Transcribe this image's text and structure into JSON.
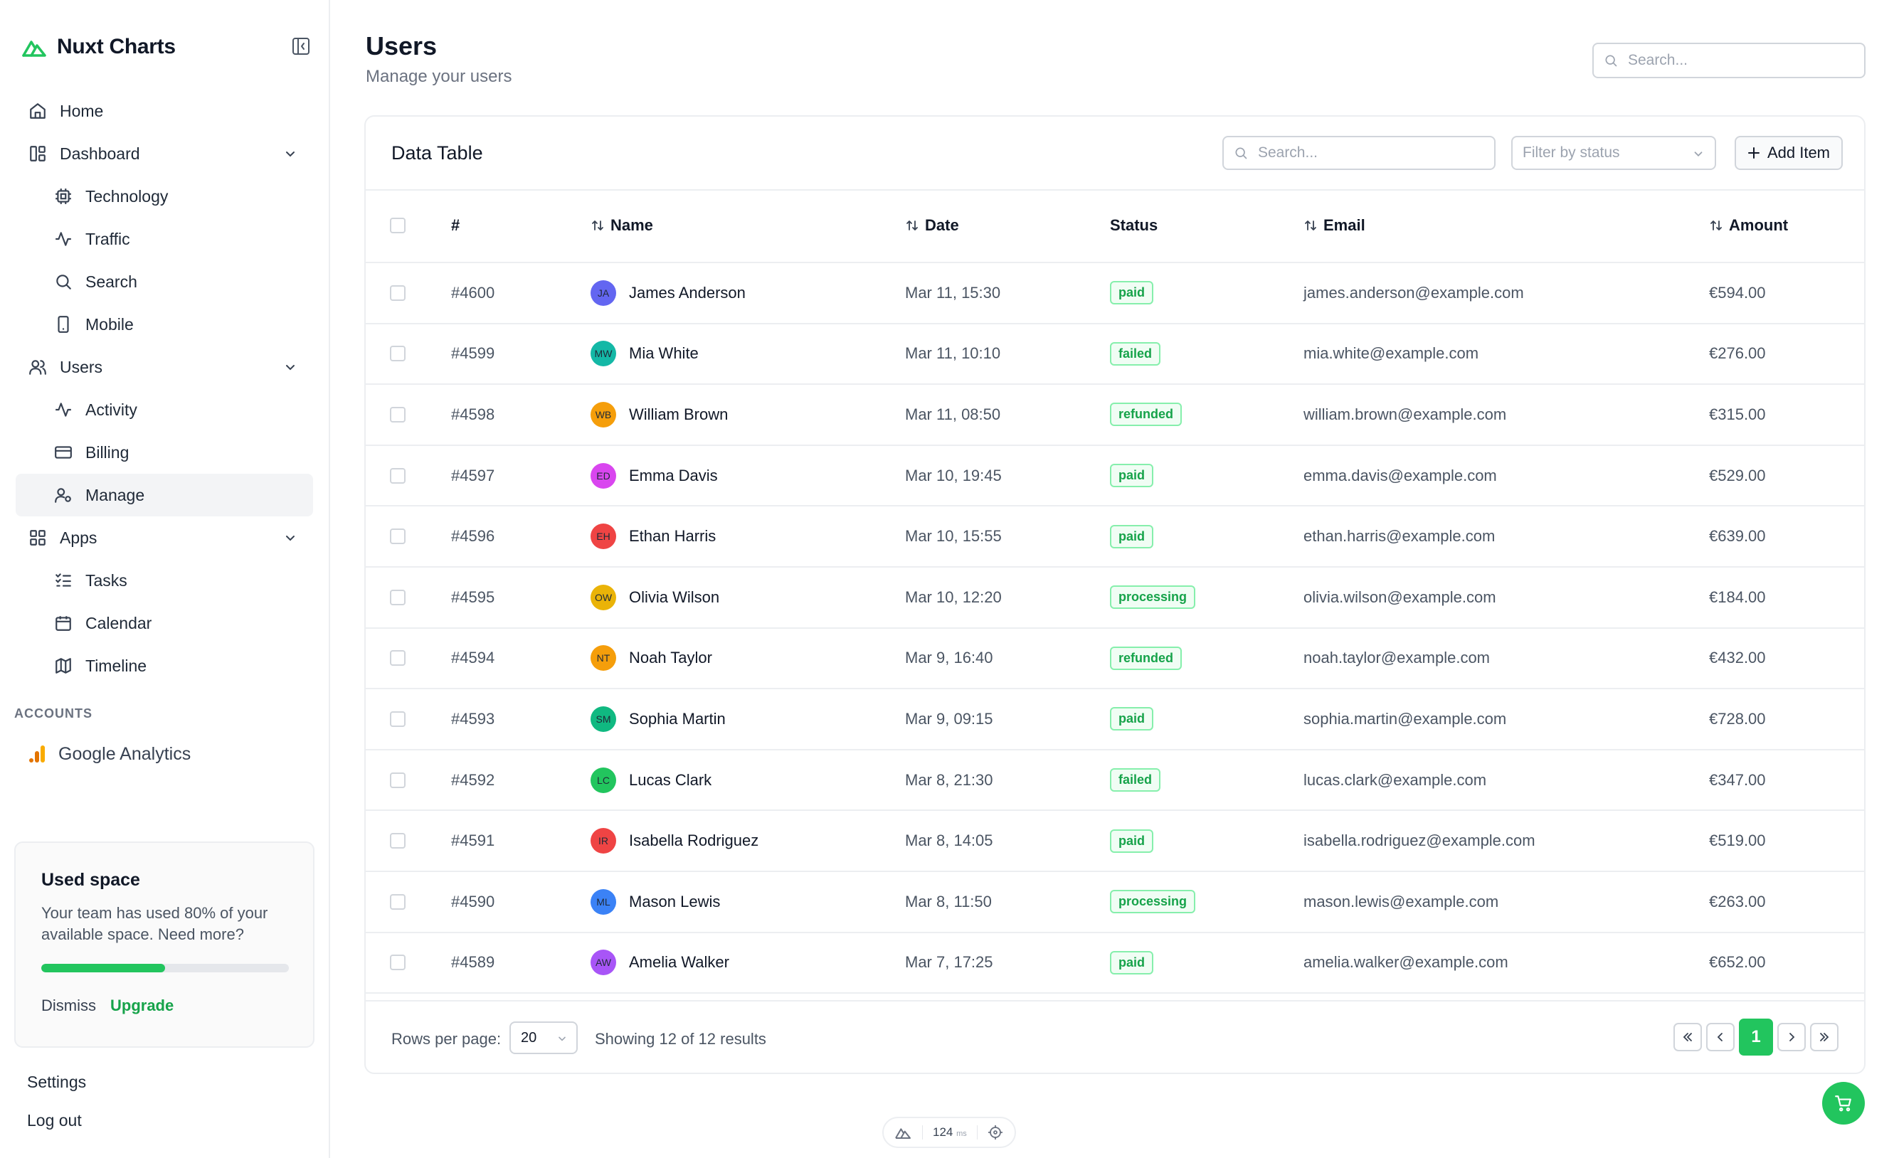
{
  "brand": {
    "name": "Nuxt Charts",
    "accent": "#22c55e"
  },
  "sidebar": {
    "items": [
      {
        "label": "Home",
        "icon": "home-icon",
        "level": 0
      },
      {
        "label": "Dashboard",
        "icon": "dashboard-icon",
        "level": 0,
        "expandable": true
      },
      {
        "label": "Technology",
        "icon": "cpu-icon",
        "level": 1
      },
      {
        "label": "Traffic",
        "icon": "activity-icon",
        "level": 1
      },
      {
        "label": "Search",
        "icon": "search-icon",
        "level": 1
      },
      {
        "label": "Mobile",
        "icon": "smartphone-icon",
        "level": 1
      },
      {
        "label": "Users",
        "icon": "users-icon",
        "level": 0,
        "expandable": true
      },
      {
        "label": "Activity",
        "icon": "activity-icon",
        "level": 1
      },
      {
        "label": "Billing",
        "icon": "credit-card-icon",
        "level": 1
      },
      {
        "label": "Manage",
        "icon": "user-cog-icon",
        "level": 1,
        "active": true
      },
      {
        "label": "Apps",
        "icon": "grid-icon",
        "level": 0,
        "expandable": true
      },
      {
        "label": "Tasks",
        "icon": "list-checks-icon",
        "level": 1
      },
      {
        "label": "Calendar",
        "icon": "calendar-icon",
        "level": 1
      },
      {
        "label": "Timeline",
        "icon": "map-icon",
        "level": 1
      }
    ],
    "accounts_label": "ACCOUNTS",
    "account": {
      "label": "Google Analytics",
      "icon": "google-analytics-icon"
    },
    "used_space": {
      "title": "Used space",
      "text": "Your team has used 80% of your available space. Need more?",
      "percent": 50,
      "dismiss": "Dismiss",
      "upgrade": "Upgrade"
    },
    "settings": "Settings",
    "logout": "Log out"
  },
  "header": {
    "title": "Users",
    "subtitle": "Manage your users",
    "search_placeholder": "Search..."
  },
  "table_card": {
    "title": "Data Table",
    "search_placeholder": "Search...",
    "filter_placeholder": "Filter by status",
    "add_label": "Add Item",
    "columns": {
      "id": "#",
      "name": "Name",
      "date": "Date",
      "status": "Status",
      "email": "Email",
      "amount": "Amount"
    },
    "rows": [
      {
        "id": "#4600",
        "initials": "JA",
        "avatar": "#6366f1",
        "name": "James Anderson",
        "date": "Mar 11, 15:30",
        "status": "paid",
        "email": "james.anderson@example.com",
        "amount": "€594.00"
      },
      {
        "id": "#4599",
        "initials": "MW",
        "avatar": "#14b8a6",
        "name": "Mia White",
        "date": "Mar 11, 10:10",
        "status": "failed",
        "email": "mia.white@example.com",
        "amount": "€276.00"
      },
      {
        "id": "#4598",
        "initials": "WB",
        "avatar": "#f59e0b",
        "name": "William Brown",
        "date": "Mar 11, 08:50",
        "status": "refunded",
        "email": "william.brown@example.com",
        "amount": "€315.00"
      },
      {
        "id": "#4597",
        "initials": "ED",
        "avatar": "#d946ef",
        "name": "Emma Davis",
        "date": "Mar 10, 19:45",
        "status": "paid",
        "email": "emma.davis@example.com",
        "amount": "€529.00"
      },
      {
        "id": "#4596",
        "initials": "EH",
        "avatar": "#ef4444",
        "name": "Ethan Harris",
        "date": "Mar 10, 15:55",
        "status": "paid",
        "email": "ethan.harris@example.com",
        "amount": "€639.00"
      },
      {
        "id": "#4595",
        "initials": "OW",
        "avatar": "#eab308",
        "name": "Olivia Wilson",
        "date": "Mar 10, 12:20",
        "status": "processing",
        "email": "olivia.wilson@example.com",
        "amount": "€184.00"
      },
      {
        "id": "#4594",
        "initials": "NT",
        "avatar": "#f59e0b",
        "name": "Noah Taylor",
        "date": "Mar 9, 16:40",
        "status": "refunded",
        "email": "noah.taylor@example.com",
        "amount": "€432.00"
      },
      {
        "id": "#4593",
        "initials": "SM",
        "avatar": "#10b981",
        "name": "Sophia Martin",
        "date": "Mar 9, 09:15",
        "status": "paid",
        "email": "sophia.martin@example.com",
        "amount": "€728.00"
      },
      {
        "id": "#4592",
        "initials": "LC",
        "avatar": "#22c55e",
        "name": "Lucas Clark",
        "date": "Mar 8, 21:30",
        "status": "failed",
        "email": "lucas.clark@example.com",
        "amount": "€347.00"
      },
      {
        "id": "#4591",
        "initials": "IR",
        "avatar": "#ef4444",
        "name": "Isabella Rodriguez",
        "date": "Mar 8, 14:05",
        "status": "paid",
        "email": "isabella.rodriguez@example.com",
        "amount": "€519.00"
      },
      {
        "id": "#4590",
        "initials": "ML",
        "avatar": "#3b82f6",
        "name": "Mason Lewis",
        "date": "Mar 8, 11:50",
        "status": "processing",
        "email": "mason.lewis@example.com",
        "amount": "€263.00"
      },
      {
        "id": "#4589",
        "initials": "AW",
        "avatar": "#a855f7",
        "name": "Amelia Walker",
        "date": "Mar 7, 17:25",
        "status": "paid",
        "email": "amelia.walker@example.com",
        "amount": "€652.00"
      }
    ],
    "footer": {
      "rows_per_page_label": "Rows per page:",
      "rows_per_page": "20",
      "showing": "Showing 12 of 12 results",
      "current_page": "1"
    }
  },
  "devbar": {
    "ms_value": "124",
    "ms_unit": "ms"
  }
}
